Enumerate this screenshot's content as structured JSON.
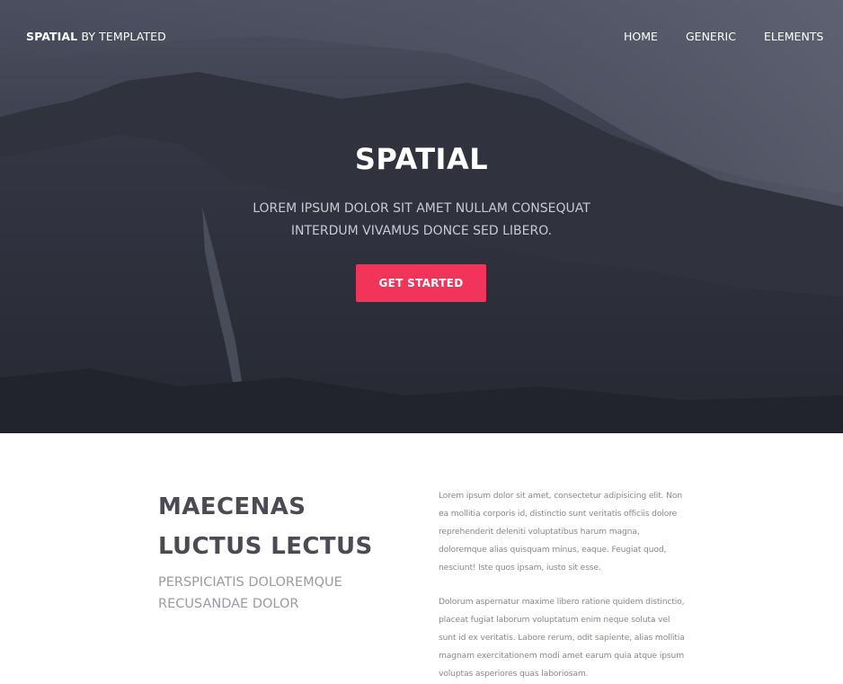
{
  "nav": {
    "brand_strong": "SPATIAL",
    "brand_rest": " BY TEMPLATED",
    "links": [
      "HOME",
      "GENERIC",
      "ELEMENTS"
    ]
  },
  "hero": {
    "title": "SPATIAL",
    "subtitle_line1": "LOREM IPSUM DOLOR SIT AMET NULLAM CONSEQUAT",
    "subtitle_line2": "INTERDUM VIVAMUS DONCE SED LIBERO.",
    "cta_label": "GET STARTED"
  },
  "intro": {
    "heading_line1": "MAECENAS",
    "heading_line2": "LUCTUS LECTUS",
    "sub_line1": "PERSPICIATIS DOLOREMQUE",
    "sub_line2": "RECUSANDAE DOLOR",
    "paragraph1": "Lorem ipsum dolor sit amet, consectetur adipisicing elit. Non ea mollitia corporis id, distinctio sunt veritatis officiis dolore reprehenderit deleniti voluptatibus harum magna, doloremque alias quisquam minus, eaque. Feugiat quod, nesciunt! Iste quos ipsam, iusto sit esse.",
    "paragraph2": "Dolorum aspernatur maxime libero ratione quidem distinctio, placeat fugiat laborum voluptatum enim neque soluta vel sunt id ex veritatis. Labore rerum, odit sapiente, alias mollitia magnam exercitationem modi amet earum quia atque ipsum voluptas asperiores quas laboriosam."
  },
  "colors": {
    "accent": "#f2345a",
    "hero_overlay": "#2b2d38",
    "heading": "#4b4a55",
    "subheading": "#9b9aa4",
    "body_text": "#8a8794"
  }
}
